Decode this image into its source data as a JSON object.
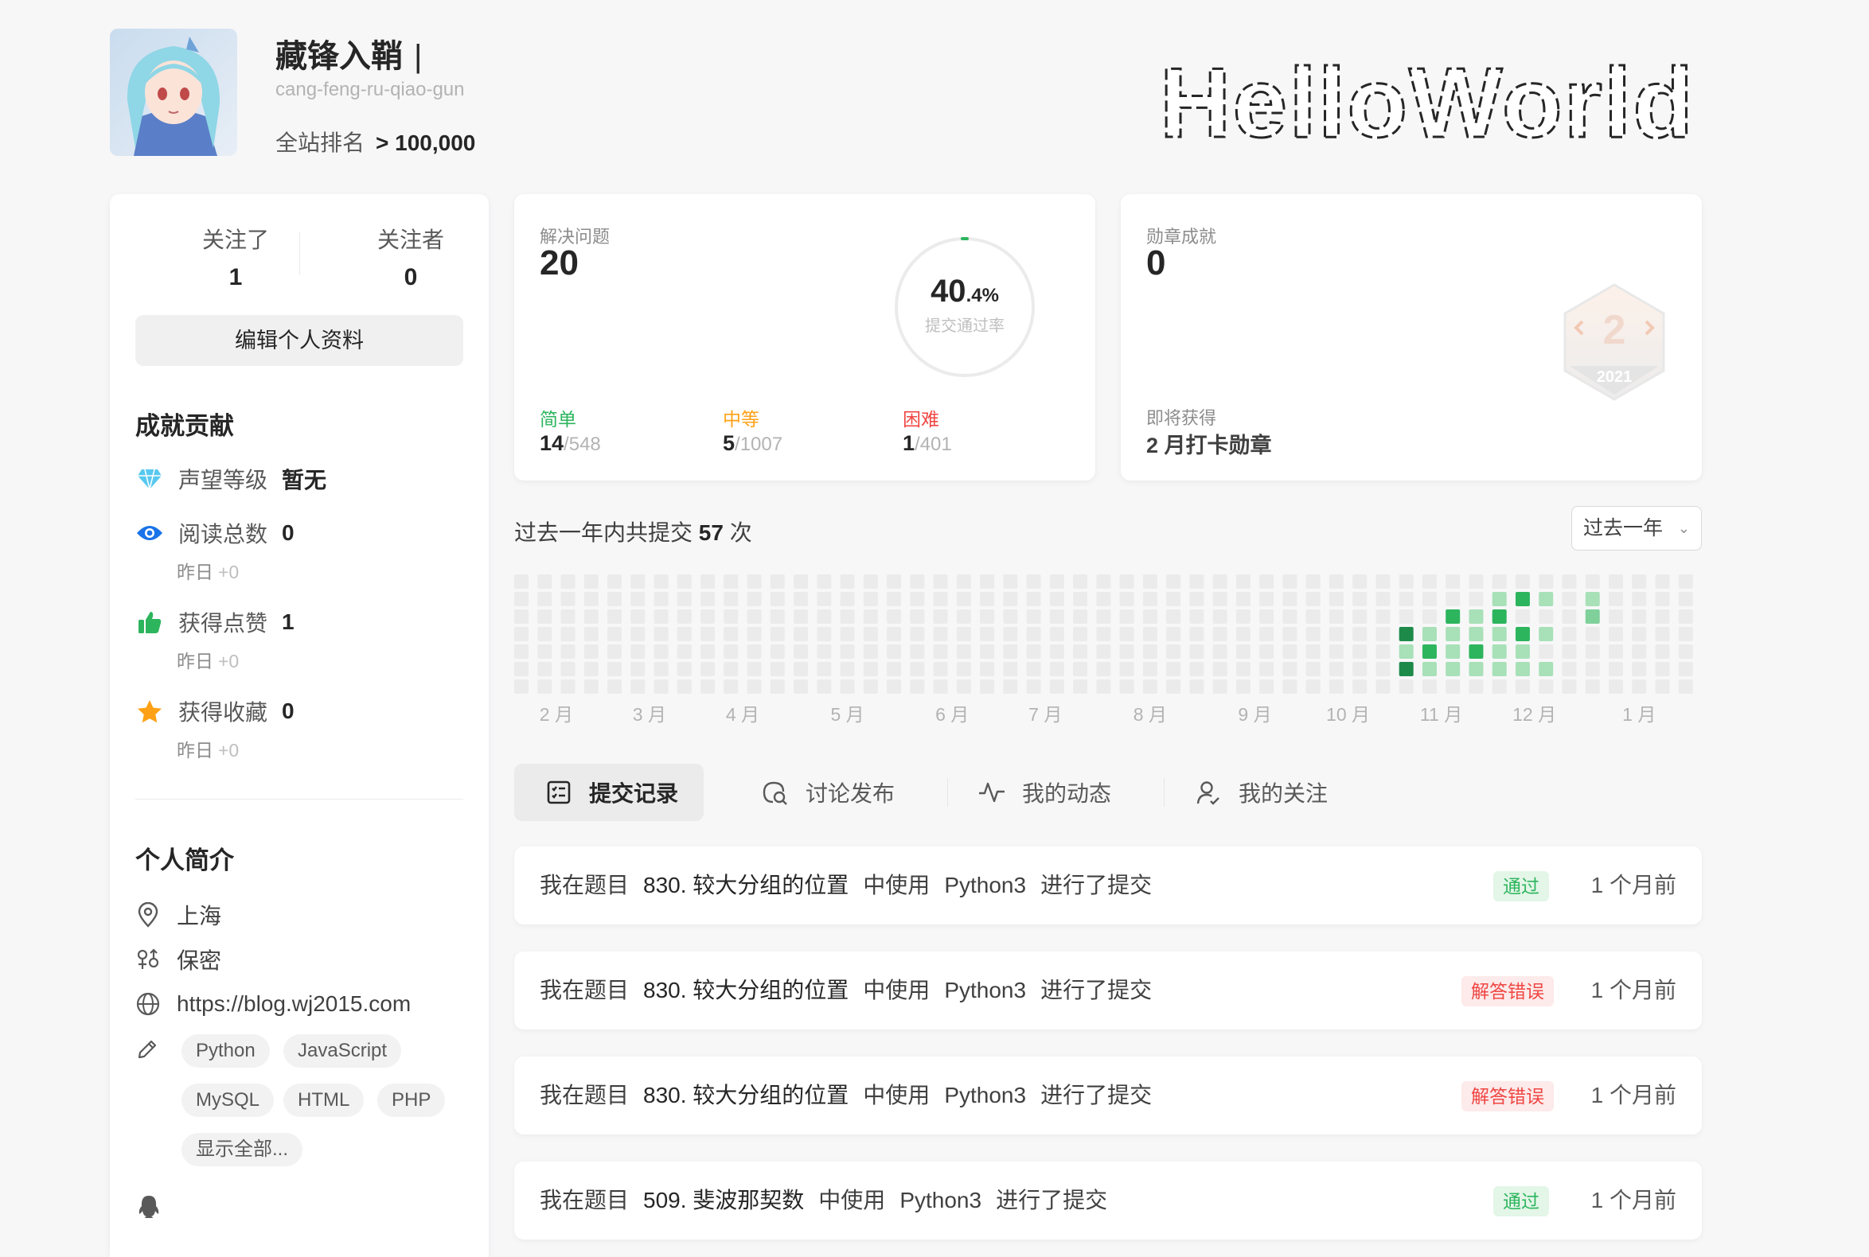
{
  "profile": {
    "name": "藏锋入鞘",
    "cursor": "|",
    "slug": "cang-feng-ru-qiao-gun",
    "rank_label": "全站排名",
    "rank_value": "> 100,000",
    "ascii_banner": "HelloWorld"
  },
  "follow": {
    "following_label": "关注了",
    "following_count": "1",
    "followers_label": "关注者",
    "followers_count": "0",
    "edit_button": "编辑个人资料"
  },
  "achievements": {
    "title": "成就贡献",
    "reputation": {
      "label": "声望等级",
      "value": "暂无"
    },
    "reads": {
      "label": "阅读总数",
      "value": "0",
      "sub": "昨日",
      "delta": "+0"
    },
    "likes": {
      "label": "获得点赞",
      "value": "1",
      "sub": "昨日",
      "delta": "+0"
    },
    "favorites": {
      "label": "获得收藏",
      "value": "0",
      "sub": "昨日",
      "delta": "+0"
    }
  },
  "bio": {
    "title": "个人简介",
    "location": "上海",
    "gender": "保密",
    "website": "https://blog.wj2015.com",
    "tags": [
      "Python",
      "JavaScript",
      "MySQL",
      "HTML",
      "PHP"
    ],
    "show_all": "显示全部..."
  },
  "solved": {
    "label": "解决问题",
    "count": "20",
    "rate_int": "40",
    "rate_dec": ".4%",
    "rate_label": "提交通过率",
    "rate_value": 0.404,
    "easy_label": "简单",
    "easy_solved": "14",
    "easy_total": "/548",
    "medium_label": "中等",
    "medium_solved": "5",
    "medium_total": "/1007",
    "hard_label": "困难",
    "hard_solved": "1",
    "hard_total": "/401",
    "colors": {
      "easy": "#2db55d",
      "medium": "#ffa116",
      "hard": "#ef4743"
    }
  },
  "badges": {
    "label": "勋章成就",
    "count": "0",
    "upcoming_label": "即将获得",
    "upcoming_name": "2 月打卡勋章",
    "badge_number": "2",
    "badge_year": "2021"
  },
  "submissions": {
    "prefix": "过去一年内共提交",
    "count": "57",
    "suffix": "次",
    "range_select": "过去一年",
    "months": [
      "2 月",
      "3 月",
      "4 月",
      "5 月",
      "6 月",
      "7 月",
      "8 月",
      "9 月",
      "10 月",
      "11 月",
      "12 月",
      "1 月"
    ]
  },
  "tabs": [
    {
      "label": "提交记录",
      "icon": "checklist-icon"
    },
    {
      "label": "讨论发布",
      "icon": "discussion-search-icon"
    },
    {
      "label": "我的动态",
      "icon": "activity-icon"
    },
    {
      "label": "我的关注",
      "icon": "user-follow-icon"
    }
  ],
  "records": [
    {
      "prefix": "我在题目",
      "problem": "830. 较大分组的位置",
      "mid": "中使用",
      "lang": "Python3",
      "suffix": "进行了提交",
      "status": "通过",
      "status_type": "pass",
      "time": "1 个月前"
    },
    {
      "prefix": "我在题目",
      "problem": "830. 较大分组的位置",
      "mid": "中使用",
      "lang": "Python3",
      "suffix": "进行了提交",
      "status": "解答错误",
      "status_type": "fail",
      "time": "1 个月前"
    },
    {
      "prefix": "我在题目",
      "problem": "830. 较大分组的位置",
      "mid": "中使用",
      "lang": "Python3",
      "suffix": "进行了提交",
      "status": "解答错误",
      "status_type": "fail",
      "time": "1 个月前"
    },
    {
      "prefix": "我在题目",
      "problem": "509. 斐波那契数",
      "mid": "中使用",
      "lang": "Python3",
      "suffix": "进行了提交",
      "status": "通过",
      "status_type": "pass",
      "time": "1 个月前"
    }
  ]
}
